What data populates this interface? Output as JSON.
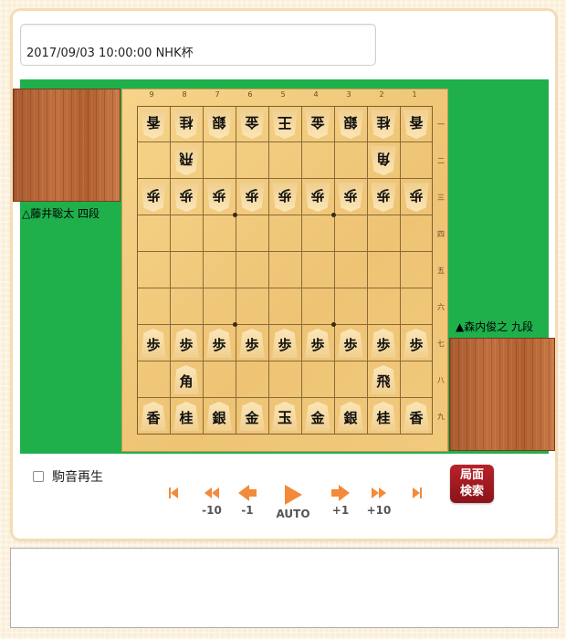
{
  "header": {
    "title": "2017/09/03 10:00:00 NHK杯"
  },
  "players": {
    "gote": "△藤井聡太 四段",
    "sente": "▲森内俊之 九段"
  },
  "board": {
    "file_labels": [
      "9",
      "8",
      "7",
      "6",
      "5",
      "4",
      "3",
      "2",
      "1"
    ],
    "rank_labels": [
      "一",
      "二",
      "三",
      "四",
      "五",
      "六",
      "七",
      "八",
      "九"
    ],
    "pieces": [
      {
        "file": 9,
        "rank": 1,
        "kanji": "香",
        "side": "gote"
      },
      {
        "file": 8,
        "rank": 1,
        "kanji": "桂",
        "side": "gote"
      },
      {
        "file": 7,
        "rank": 1,
        "kanji": "銀",
        "side": "gote"
      },
      {
        "file": 6,
        "rank": 1,
        "kanji": "金",
        "side": "gote"
      },
      {
        "file": 5,
        "rank": 1,
        "kanji": "王",
        "side": "gote"
      },
      {
        "file": 4,
        "rank": 1,
        "kanji": "金",
        "side": "gote"
      },
      {
        "file": 3,
        "rank": 1,
        "kanji": "銀",
        "side": "gote"
      },
      {
        "file": 2,
        "rank": 1,
        "kanji": "桂",
        "side": "gote"
      },
      {
        "file": 1,
        "rank": 1,
        "kanji": "香",
        "side": "gote"
      },
      {
        "file": 8,
        "rank": 2,
        "kanji": "飛",
        "side": "gote"
      },
      {
        "file": 2,
        "rank": 2,
        "kanji": "角",
        "side": "gote"
      },
      {
        "file": 9,
        "rank": 3,
        "kanji": "歩",
        "side": "gote"
      },
      {
        "file": 8,
        "rank": 3,
        "kanji": "歩",
        "side": "gote"
      },
      {
        "file": 7,
        "rank": 3,
        "kanji": "歩",
        "side": "gote"
      },
      {
        "file": 6,
        "rank": 3,
        "kanji": "歩",
        "side": "gote"
      },
      {
        "file": 5,
        "rank": 3,
        "kanji": "歩",
        "side": "gote"
      },
      {
        "file": 4,
        "rank": 3,
        "kanji": "歩",
        "side": "gote"
      },
      {
        "file": 3,
        "rank": 3,
        "kanji": "歩",
        "side": "gote"
      },
      {
        "file": 2,
        "rank": 3,
        "kanji": "歩",
        "side": "gote"
      },
      {
        "file": 1,
        "rank": 3,
        "kanji": "歩",
        "side": "gote"
      },
      {
        "file": 9,
        "rank": 7,
        "kanji": "歩",
        "side": "sente"
      },
      {
        "file": 8,
        "rank": 7,
        "kanji": "歩",
        "side": "sente"
      },
      {
        "file": 7,
        "rank": 7,
        "kanji": "歩",
        "side": "sente"
      },
      {
        "file": 6,
        "rank": 7,
        "kanji": "歩",
        "side": "sente"
      },
      {
        "file": 5,
        "rank": 7,
        "kanji": "歩",
        "side": "sente"
      },
      {
        "file": 4,
        "rank": 7,
        "kanji": "歩",
        "side": "sente"
      },
      {
        "file": 3,
        "rank": 7,
        "kanji": "歩",
        "side": "sente"
      },
      {
        "file": 2,
        "rank": 7,
        "kanji": "歩",
        "side": "sente"
      },
      {
        "file": 1,
        "rank": 7,
        "kanji": "歩",
        "side": "sente"
      },
      {
        "file": 8,
        "rank": 8,
        "kanji": "角",
        "side": "sente"
      },
      {
        "file": 2,
        "rank": 8,
        "kanji": "飛",
        "side": "sente"
      },
      {
        "file": 9,
        "rank": 9,
        "kanji": "香",
        "side": "sente"
      },
      {
        "file": 8,
        "rank": 9,
        "kanji": "桂",
        "side": "sente"
      },
      {
        "file": 7,
        "rank": 9,
        "kanji": "銀",
        "side": "sente"
      },
      {
        "file": 6,
        "rank": 9,
        "kanji": "金",
        "side": "sente"
      },
      {
        "file": 5,
        "rank": 9,
        "kanji": "玉",
        "side": "sente"
      },
      {
        "file": 4,
        "rank": 9,
        "kanji": "金",
        "side": "sente"
      },
      {
        "file": 3,
        "rank": 9,
        "kanji": "銀",
        "side": "sente"
      },
      {
        "file": 2,
        "rank": 9,
        "kanji": "桂",
        "side": "sente"
      },
      {
        "file": 1,
        "rank": 9,
        "kanji": "香",
        "side": "sente"
      }
    ]
  },
  "controls": {
    "sound_label": "駒音再生",
    "sound_checked": false,
    "buttons": {
      "first": "",
      "back10": "-10",
      "back1": "-1",
      "auto": "AUTO",
      "fwd1": "+1",
      "fwd10": "+10",
      "last": ""
    },
    "search_line1": "局面",
    "search_line2": "検索"
  },
  "kifu_text": {
    "value": ""
  },
  "colors": {
    "accent": "#f28a3a",
    "table_green": "#1fb04c",
    "search_red": "#a01c22"
  }
}
